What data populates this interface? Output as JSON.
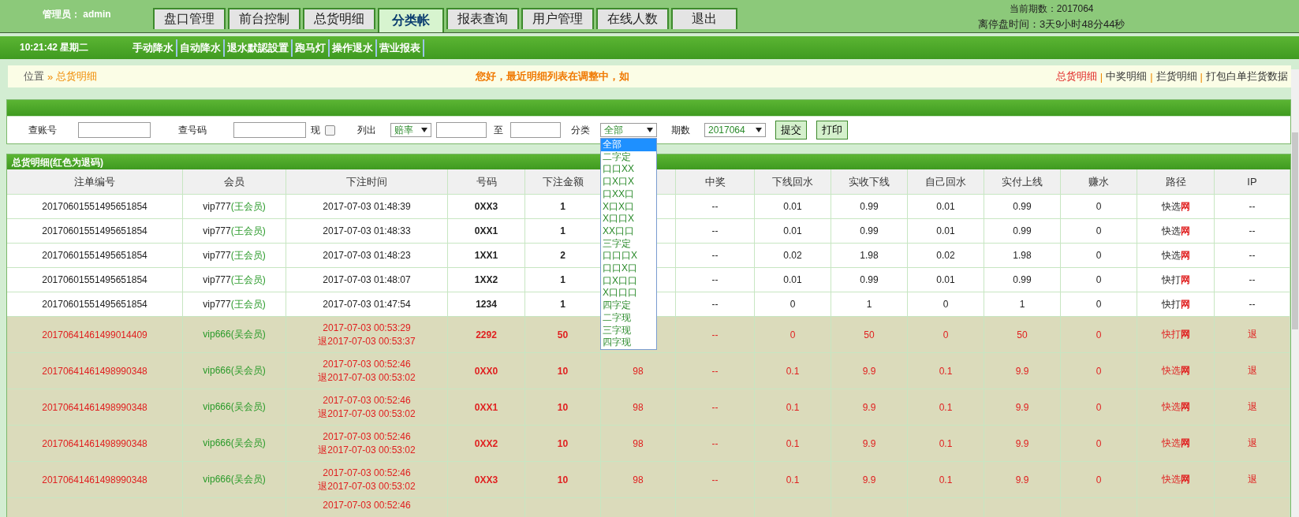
{
  "header": {
    "admin_label": "管理员： admin",
    "tabs": [
      {
        "label": "盘口管理",
        "selected": false
      },
      {
        "label": "前台控制",
        "selected": false
      },
      {
        "label": "总货明细",
        "selected": false
      },
      {
        "label": "分类帐",
        "selected": true
      },
      {
        "label": "报表查询",
        "selected": false
      },
      {
        "label": "用户管理",
        "selected": false
      },
      {
        "label": "在线人数",
        "selected": false
      },
      {
        "label": "退出",
        "selected": false
      }
    ],
    "period": "当前期数：2017064",
    "countdown": "离停盘时间：3天9小时48分44秒"
  },
  "nav": {
    "clock": "10:21:42 星期二",
    "links": [
      "手动降水",
      "自动降水",
      "退水默認設置",
      "跑马灯",
      "操作退水",
      "营业报表"
    ]
  },
  "breadcrumb": {
    "label": "位置",
    "separator": "»",
    "current": "总货明细",
    "notice": "您好，最近明细列表在调整中，如",
    "links": [
      {
        "label": "总货明细",
        "selected": true
      },
      {
        "label": "中奖明细",
        "selected": false
      },
      {
        "label": "拦货明细",
        "selected": false
      },
      {
        "label": "打包白单拦货数据",
        "selected": false
      }
    ],
    "link_separator": "|"
  },
  "filter": {
    "account_label": "查账号",
    "number_label": "查号码",
    "show_label": "现",
    "show_checked": false,
    "list_label": "列出",
    "list_select": "赔率",
    "range_label": "至",
    "category_label": "分类",
    "category_select": "全部",
    "category_options": [
      {
        "label": "全部",
        "selected": true
      },
      {
        "label": "二字定",
        "selected": false
      },
      {
        "label": "口口XX",
        "selected": false
      },
      {
        "label": "口X口X",
        "selected": false
      },
      {
        "label": "口XX口",
        "selected": false
      },
      {
        "label": "X口X口",
        "selected": false
      },
      {
        "label": "X口口X",
        "selected": false
      },
      {
        "label": "XX口口",
        "selected": false
      },
      {
        "label": "三字定",
        "selected": false
      },
      {
        "label": "口口口X",
        "selected": false
      },
      {
        "label": "口口X口",
        "selected": false
      },
      {
        "label": "口X口口",
        "selected": false
      },
      {
        "label": "X口口口",
        "selected": false
      },
      {
        "label": "四字定",
        "selected": false
      },
      {
        "label": "二字现",
        "selected": false
      },
      {
        "label": "三字现",
        "selected": false
      },
      {
        "label": "四字现",
        "selected": false
      }
    ],
    "period_label": "期数",
    "period_select": "2017064",
    "buttons": [
      "提交",
      "打印"
    ]
  },
  "table": {
    "title": "总货明细(红色为退码)",
    "columns": [
      {
        "label": "注单编号",
        "kind": "text"
      },
      {
        "label": "会员",
        "kind": "member"
      },
      {
        "label": "下注时间",
        "kind": "time"
      },
      {
        "label": "号码",
        "kind": "bold"
      },
      {
        "label": "下注金额",
        "kind": "bold"
      },
      {
        "kind": "text"
      },
      {
        "label": "中奖",
        "kind": "text"
      },
      {
        "label": "下线回水",
        "kind": "text"
      },
      {
        "label": "实收下线",
        "kind": "text"
      },
      {
        "label": "自己回水",
        "kind": "text"
      },
      {
        "label": "实付上线",
        "kind": "text"
      },
      {
        "label": "赚水",
        "kind": "text"
      },
      {
        "label": "路径",
        "kind": "route"
      },
      {
        "label": "IP",
        "kind": "text"
      }
    ],
    "rows": [
      {
        "refunded": false,
        "cells": [
          "20170601551495651854",
          {
            "text": "vip777",
            "tag": "(王会员)"
          },
          {
            "text": "2017-07-03 01:48:39"
          },
          "0XX3",
          "1",
          null,
          "--",
          "0.01",
          "0.99",
          "0.01",
          "0.99",
          "0",
          {
            "text": "快选",
            "mark": "网"
          },
          "--"
        ]
      },
      {
        "refunded": false,
        "cells": [
          "20170601551495651854",
          {
            "text": "vip777",
            "tag": "(王会员)"
          },
          {
            "text": "2017-07-03 01:48:33"
          },
          "0XX1",
          "1",
          null,
          "--",
          "0.01",
          "0.99",
          "0.01",
          "0.99",
          "0",
          {
            "text": "快选",
            "mark": "网"
          },
          "--"
        ]
      },
      {
        "refunded": false,
        "cells": [
          "20170601551495651854",
          {
            "text": "vip777",
            "tag": "(王会员)"
          },
          {
            "text": "2017-07-03 01:48:23"
          },
          "1XX1",
          "2",
          null,
          "--",
          "0.02",
          "1.98",
          "0.02",
          "1.98",
          "0",
          {
            "text": "快选",
            "mark": "网"
          },
          "--"
        ]
      },
      {
        "refunded": false,
        "cells": [
          "20170601551495651854",
          {
            "text": "vip777",
            "tag": "(王会员)"
          },
          {
            "text": "2017-07-03 01:48:07"
          },
          "1XX2",
          "1",
          null,
          "--",
          "0.01",
          "0.99",
          "0.01",
          "0.99",
          "0",
          {
            "text": "快打",
            "mark": "网"
          },
          "--"
        ]
      },
      {
        "refunded": false,
        "cells": [
          "20170601551495651854",
          {
            "text": "vip777",
            "tag": "(王会员)"
          },
          {
            "text": "2017-07-03 01:47:54"
          },
          "1234",
          "1",
          null,
          "--",
          "0",
          "1",
          "0",
          "1",
          "0",
          {
            "text": "快打",
            "mark": "网"
          },
          "--"
        ]
      },
      {
        "refunded": true,
        "cells": [
          "20170641461499014409",
          {
            "text": "vip666",
            "tag": "(吴会员)"
          },
          {
            "text": "2017-07-03 00:53:29",
            "refund": "退2017-07-03 00:53:37"
          },
          "2292",
          "50",
          null,
          "--",
          "0",
          "50",
          "0",
          "50",
          "0",
          {
            "text": "快打",
            "mark": "网"
          },
          "退"
        ]
      },
      {
        "refunded": true,
        "cells": [
          "20170641461498990348",
          {
            "text": "vip666",
            "tag": "(吴会员)"
          },
          {
            "text": "2017-07-03 00:52:46",
            "refund": "退2017-07-03 00:53:02"
          },
          "0XX0",
          "10",
          "98",
          "--",
          "0.1",
          "9.9",
          "0.1",
          "9.9",
          "0",
          {
            "text": "快选",
            "mark": "网"
          },
          "退"
        ]
      },
      {
        "refunded": true,
        "cells": [
          "20170641461498990348",
          {
            "text": "vip666",
            "tag": "(吴会员)"
          },
          {
            "text": "2017-07-03 00:52:46",
            "refund": "退2017-07-03 00:53:02"
          },
          "0XX1",
          "10",
          "98",
          "--",
          "0.1",
          "9.9",
          "0.1",
          "9.9",
          "0",
          {
            "text": "快选",
            "mark": "网"
          },
          "退"
        ]
      },
      {
        "refunded": true,
        "cells": [
          "20170641461498990348",
          {
            "text": "vip666",
            "tag": "(吴会员)"
          },
          {
            "text": "2017-07-03 00:52:46",
            "refund": "退2017-07-03 00:53:02"
          },
          "0XX2",
          "10",
          "98",
          "--",
          "0.1",
          "9.9",
          "0.1",
          "9.9",
          "0",
          {
            "text": "快选",
            "mark": "网"
          },
          "退"
        ]
      },
      {
        "refunded": true,
        "cells": [
          "20170641461498990348",
          {
            "text": "vip666",
            "tag": "(吴会员)"
          },
          {
            "text": "2017-07-03 00:52:46",
            "refund": "退2017-07-03 00:53:02"
          },
          "0XX3",
          "10",
          "98",
          "--",
          "0.1",
          "9.9",
          "0.1",
          "9.9",
          "0",
          {
            "text": "快选",
            "mark": "网"
          },
          "退"
        ]
      },
      {
        "refunded": true,
        "cells": [
          null,
          null,
          {
            "text": "2017-07-03 00:52:46"
          },
          null,
          null,
          null,
          null,
          null,
          null,
          null,
          null,
          null,
          null,
          null
        ]
      }
    ]
  }
}
